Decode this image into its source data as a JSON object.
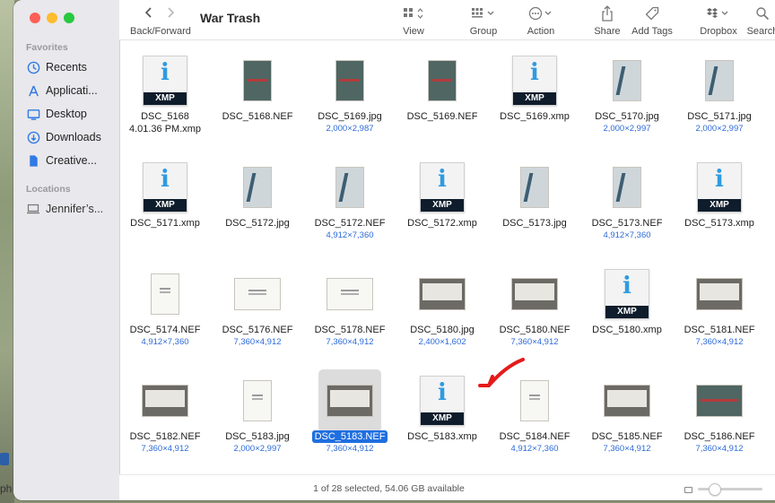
{
  "window": {
    "title": "War Trash"
  },
  "toolbar": {
    "back_forward_label": "Back/Forward",
    "view_label": "View",
    "group_label": "Group",
    "action_label": "Action",
    "share_label": "Share",
    "add_tags_label": "Add Tags",
    "dropbox_label": "Dropbox",
    "search_label": "Search"
  },
  "sidebar": {
    "favorites_header": "Favorites",
    "locations_header": "Locations",
    "favorites": [
      {
        "label": "Recents",
        "icon": "clock-icon"
      },
      {
        "label": "Applicati...",
        "icon": "applications-icon"
      },
      {
        "label": "Desktop",
        "icon": "desktop-icon"
      },
      {
        "label": "Downloads",
        "icon": "download-icon"
      },
      {
        "label": "Creative...",
        "icon": "document-icon"
      }
    ],
    "locations": [
      {
        "label": "Jennifer’s...",
        "icon": "laptop-icon"
      }
    ]
  },
  "files": [
    {
      "name": "DSC_5168",
      "name2": "4.01.36 PM.xmp",
      "dims": "",
      "kind": "xmp"
    },
    {
      "name": "DSC_5168.NEF",
      "dims": "",
      "kind": "book"
    },
    {
      "name": "DSC_5169.jpg",
      "dims": "2,000×2,987",
      "kind": "book"
    },
    {
      "name": "DSC_5169.NEF",
      "dims": "",
      "kind": "book"
    },
    {
      "name": "DSC_5169.xmp",
      "dims": "",
      "kind": "xmp"
    },
    {
      "name": "DSC_5170.jpg",
      "dims": "2,000×2,997",
      "kind": "spiral"
    },
    {
      "name": "DSC_5171.jpg",
      "dims": "2,000×2,997",
      "kind": "spiral"
    },
    {
      "name": "DSC_5171.xmp",
      "dims": "",
      "kind": "xmp"
    },
    {
      "name": "DSC_5172.jpg",
      "dims": "",
      "kind": "spiral"
    },
    {
      "name": "DSC_5172.NEF",
      "dims": "4,912×7,360",
      "kind": "spiral"
    },
    {
      "name": "DSC_5172.xmp",
      "dims": "",
      "kind": "xmp"
    },
    {
      "name": "DSC_5173.jpg",
      "dims": "",
      "kind": "spiral"
    },
    {
      "name": "DSC_5173.NEF",
      "dims": "4,912×7,360",
      "kind": "spiral"
    },
    {
      "name": "DSC_5173.xmp",
      "dims": "",
      "kind": "xmp"
    },
    {
      "name": "DSC_5174.NEF",
      "dims": "4,912×7,360",
      "kind": "sheet-tall"
    },
    {
      "name": "DSC_5176.NEF",
      "dims": "7,360×4,912",
      "kind": "sheet-wide"
    },
    {
      "name": "DSC_5178.NEF",
      "dims": "7,360×4,912",
      "kind": "sheet-wide"
    },
    {
      "name": "DSC_5180.jpg",
      "dims": "2,400×1,602",
      "kind": "dark-wide"
    },
    {
      "name": "DSC_5180.NEF",
      "dims": "7,360×4,912",
      "kind": "dark-wide"
    },
    {
      "name": "DSC_5180.xmp",
      "dims": "",
      "kind": "xmp"
    },
    {
      "name": "DSC_5181.NEF",
      "dims": "7,360×4,912",
      "kind": "dark-wide"
    },
    {
      "name": "DSC_5182.NEF",
      "dims": "7,360×4,912",
      "kind": "dark-wide"
    },
    {
      "name": "DSC_5183.jpg",
      "dims": "2,000×2,997",
      "kind": "sheet-tall"
    },
    {
      "name": "DSC_5183.NEF",
      "dims": "7,360×4,912",
      "kind": "dark-wide",
      "selected": true
    },
    {
      "name": "DSC_5183.xmp",
      "dims": "",
      "kind": "xmp"
    },
    {
      "name": "DSC_5184.NEF",
      "dims": "4,912×7,360",
      "kind": "sheet-tall"
    },
    {
      "name": "DSC_5185.NEF",
      "dims": "7,360×4,912",
      "kind": "dark-wide"
    },
    {
      "name": "DSC_5186.NEF",
      "dims": "7,360×4,912",
      "kind": "book-wide"
    }
  ],
  "xmp_badge": "XMP",
  "xmp_letter": "i",
  "status": {
    "text": "1 of 28 selected, 54.06 GB available"
  },
  "zoom_slider": {
    "value": 0.25
  },
  "desktop_fragment": "ph",
  "colors": {
    "accent": "#1f6fe0",
    "annotation_arrow": "#e41b1b"
  }
}
